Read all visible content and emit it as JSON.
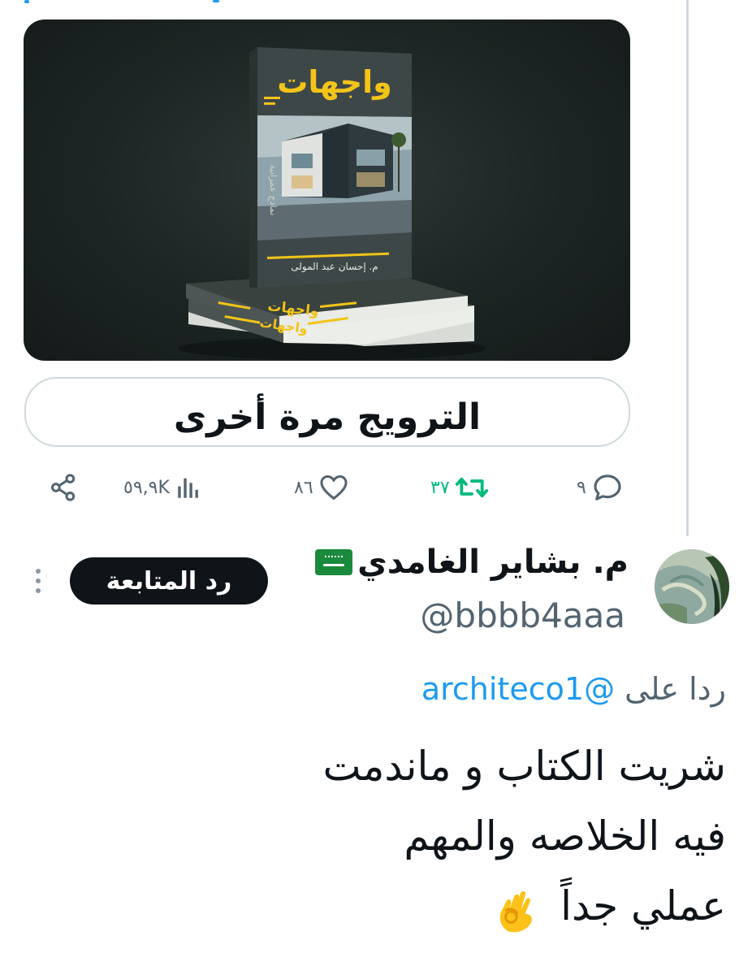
{
  "media": {
    "book_title": "واجهات",
    "author_line": "م. إحسان عبد المولى",
    "spine_text": "نماذج عمرانية",
    "colors": {
      "background": "#1d2524",
      "title_yellow": "#f2c418"
    }
  },
  "translate_bar": {
    "label": "الترويج مرة أخرى"
  },
  "actions": {
    "replies": "٩",
    "retweets": "٣٧",
    "likes": "٨٦",
    "views": "٥٩,٩K"
  },
  "user": {
    "name": "م. بشاير الغامدي",
    "handle": "@bbbb4aaa",
    "follow_label": "رد المتابعة"
  },
  "reply": {
    "prefix": "ردا على",
    "mention": "@architeco1",
    "lines": [
      "شريت الكتاب و ماندمت",
      "فيه الخلاصه والمهم",
      "عملي جداً"
    ]
  },
  "colors": {
    "accent": "#1d9bf0",
    "retweet": "#00ba7c",
    "muted": "#536471"
  }
}
